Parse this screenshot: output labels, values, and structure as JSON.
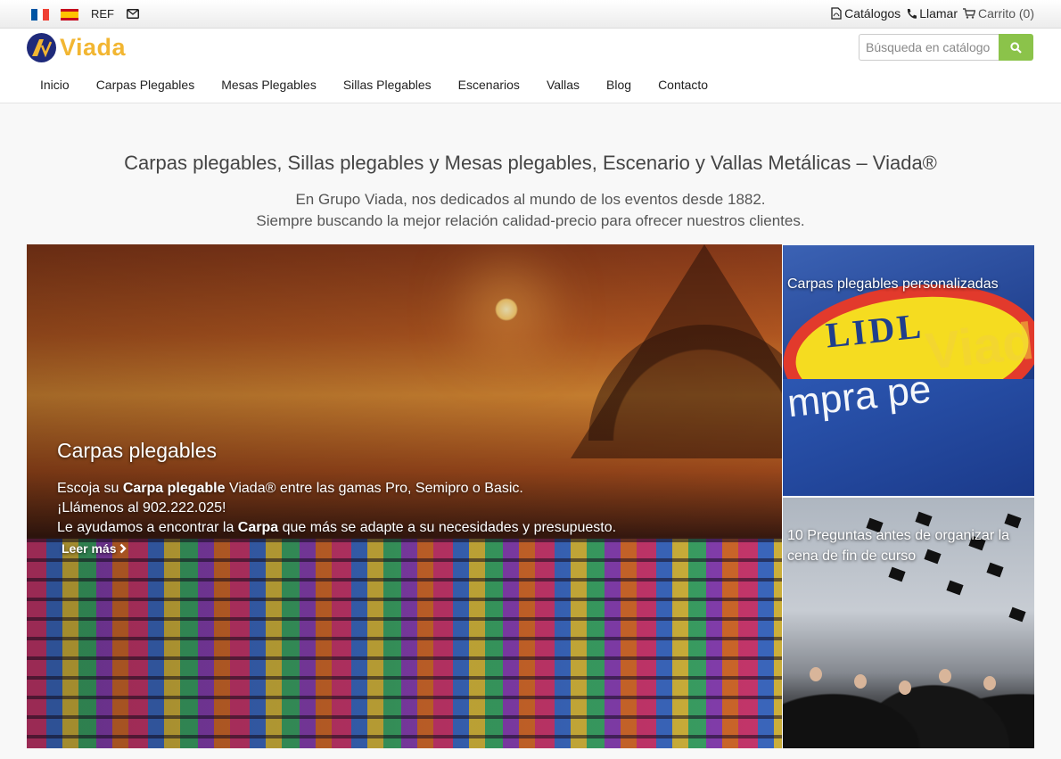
{
  "topbar": {
    "lang_ref": "REF",
    "links": {
      "catalogs": "Catálogos",
      "call": "Llamar",
      "cart": "Carrito (0)"
    },
    "icons": [
      "flag-france-icon",
      "flag-spain-icon",
      "envelope-icon",
      "pdf-file-icon",
      "phone-icon",
      "cart-icon"
    ]
  },
  "header": {
    "logo_text": "Viada",
    "search": {
      "placeholder": "Búsqueda en catálogo"
    },
    "nav": [
      "Inicio",
      "Carpas Plegables",
      "Mesas Plegables",
      "Sillas Plegables",
      "Escenarios",
      "Vallas",
      "Blog",
      "Contacto"
    ]
  },
  "intro": {
    "title": "Carpas plegables, Sillas plegables y Mesas plegables, Escenario y Vallas Metálicas – Viada®",
    "line1": "En Grupo Viada, nos dedicados al mundo de los eventos desde 1882.",
    "line2": "Siempre buscando la mejor relación calidad-precio para ofrecer nuestros clientes."
  },
  "hero": {
    "title": "Carpas plegables",
    "line1_a": "Escoja su ",
    "line1_b": "Carpa plegable",
    "line1_c": " Viada® entre las gamas Pro, Semipro o Basic.",
    "line2": "¡Llámenos al 902.222.025!",
    "line3_a": "Le ayudamos a encontrar la ",
    "line3_b": "Carpa",
    "line3_c": " que más se adapte a su necesidades y presupuesto.",
    "more": "Leer más"
  },
  "cards": [
    {
      "title": "Carpas plegables personalizadas",
      "logo_text": "LIDL",
      "image_text": "mpra pe",
      "image_brand": "Viad"
    },
    {
      "title": "10 Preguntas antes de organizar la cena de fin de curso"
    }
  ],
  "colors": {
    "brand_yellow": "#f2b632",
    "brand_blue": "#1f2a7a",
    "search_button": "#8bc34a"
  }
}
